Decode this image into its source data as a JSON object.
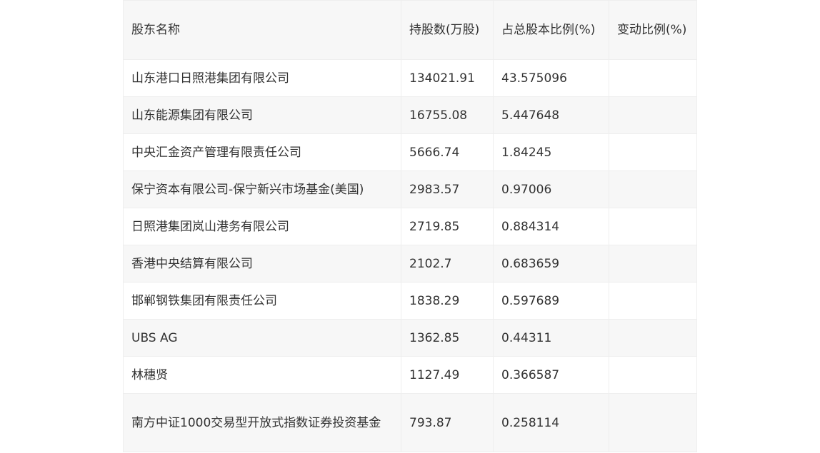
{
  "table": {
    "headers": [
      "股东名称",
      "持股数(万股)",
      "占总股本比例(%)",
      "变动比例(%)"
    ],
    "rows": [
      [
        "山东港口日照港集团有限公司",
        "134021.91",
        "43.575096",
        ""
      ],
      [
        "山东能源集团有限公司",
        "16755.08",
        "5.447648",
        ""
      ],
      [
        "中央汇金资产管理有限责任公司",
        "5666.74",
        "1.84245",
        ""
      ],
      [
        "保宁资本有限公司-保宁新兴市场基金(美国)",
        "2983.57",
        "0.97006",
        ""
      ],
      [
        "日照港集团岚山港务有限公司",
        "2719.85",
        "0.884314",
        ""
      ],
      [
        "香港中央结算有限公司",
        "2102.7",
        "0.683659",
        ""
      ],
      [
        "邯郸钢铁集团有限责任公司",
        "1838.29",
        "0.597689",
        ""
      ],
      [
        "UBS AG",
        "1362.85",
        "0.44311",
        ""
      ],
      [
        "林穗贤",
        "1127.49",
        "0.366587",
        ""
      ],
      [
        "南方中证1000交易型开放式指数证券投资基金",
        "793.87",
        "0.258114",
        ""
      ]
    ]
  }
}
